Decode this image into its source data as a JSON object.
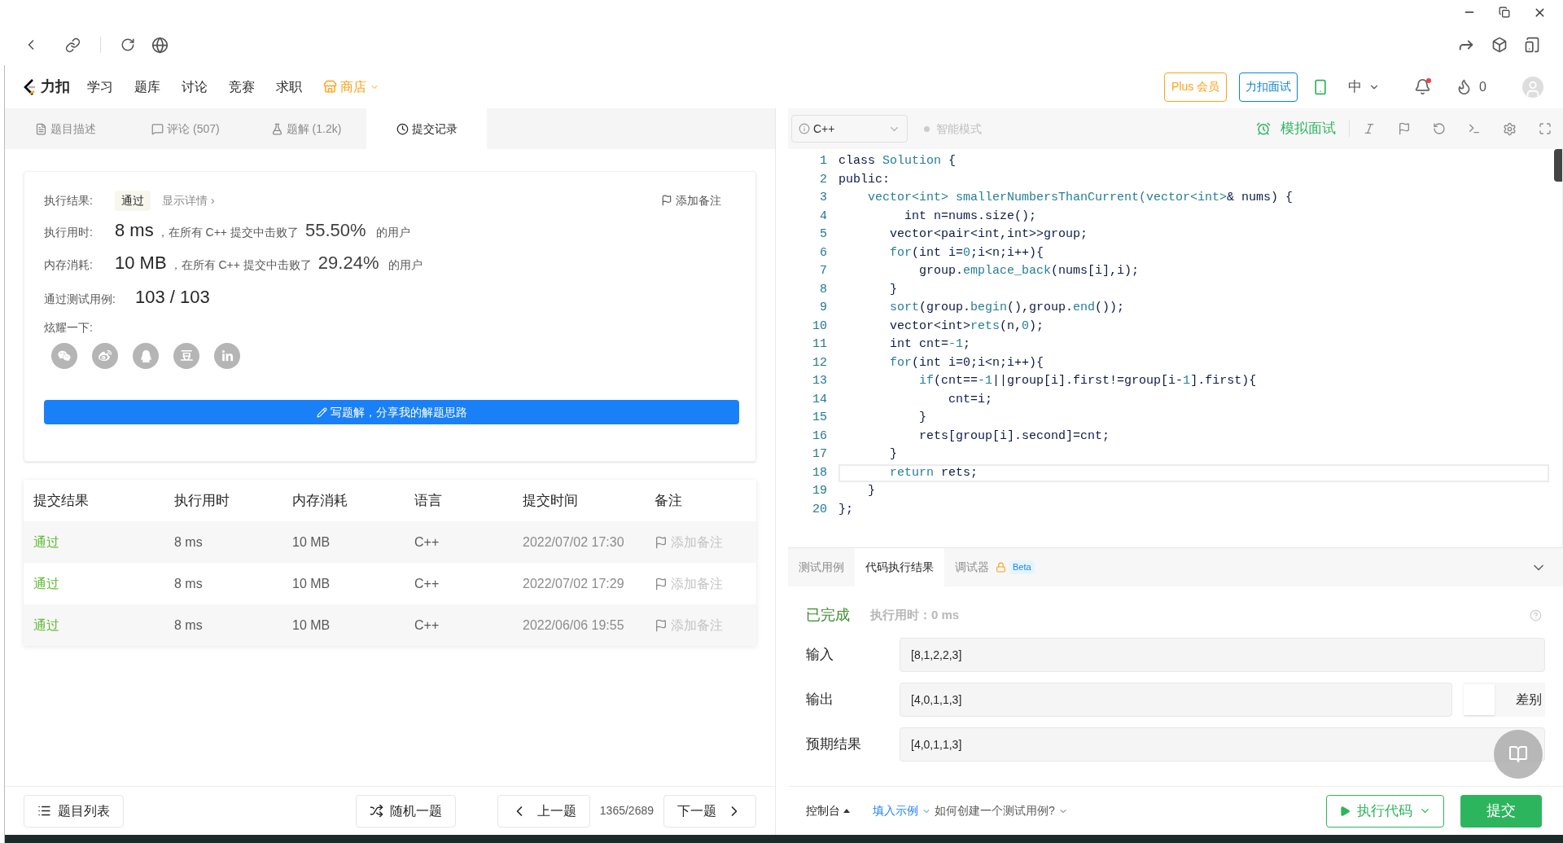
{
  "nav": {
    "logo": "力扣",
    "items": [
      {
        "label": "学习"
      },
      {
        "label": "题库"
      },
      {
        "label": "讨论"
      },
      {
        "label": "竞赛"
      },
      {
        "label": "求职"
      }
    ],
    "shop": "商店",
    "plus": "Plus 会员",
    "interview": "力扣面试",
    "language": "中",
    "coins": "0"
  },
  "left_tabs": [
    {
      "kind": "description",
      "label": "题目描述",
      "selected": false
    },
    {
      "kind": "comments",
      "label": "评论 (507)",
      "selected": false
    },
    {
      "kind": "solutions",
      "label": "题解 (1.2k)",
      "selected": false
    },
    {
      "kind": "submissions",
      "label": "提交记录",
      "selected": true
    }
  ],
  "result": {
    "status_label": "执行结果:",
    "status": "通过",
    "details": "显示详情 ›",
    "add_note": "添加备注",
    "runtime_label": "执行用时:",
    "runtime": "8 ms",
    "runtime_text": "，在所有 C++ 提交中击败了",
    "runtime_pct": "55.50%",
    "runtime_suffix": "的用户",
    "memory_label": "内存消耗:",
    "memory": "10 MB",
    "memory_text": "，在所有 C++ 提交中击败了",
    "memory_pct": "29.24%",
    "memory_suffix": "的用户",
    "tests_label": "通过测试用例:",
    "tests": "103 / 103",
    "share_label": "炫耀一下:",
    "share": [
      {
        "kind": "wechat"
      },
      {
        "kind": "weibo"
      },
      {
        "kind": "qq"
      },
      {
        "kind": "douban",
        "glyph": "豆"
      },
      {
        "kind": "linkedin"
      }
    ],
    "write_button": "写题解，分享我的解题思路"
  },
  "submissions": {
    "columns": [
      "提交结果",
      "执行用时",
      "内存消耗",
      "语言",
      "提交时间",
      "备注"
    ],
    "rows": [
      {
        "status": "通过",
        "runtime": "8 ms",
        "memory": "10 MB",
        "language": "C++",
        "time": "2022/07/02 17:30",
        "note": "添加备注"
      },
      {
        "status": "通过",
        "runtime": "8 ms",
        "memory": "10 MB",
        "language": "C++",
        "time": "2022/07/02 17:29",
        "note": "添加备注"
      },
      {
        "status": "通过",
        "runtime": "8 ms",
        "memory": "10 MB",
        "language": "C++",
        "time": "2022/06/06 19:55",
        "note": "添加备注"
      }
    ]
  },
  "footer": {
    "list": "题目列表",
    "random": "随机一题",
    "prev": "上一题",
    "counter": "1365/2689",
    "next": "下一题"
  },
  "editor": {
    "language": "C++",
    "smart_mode": "智能模式",
    "mock": "模拟面试",
    "lines": [
      {
        "n": "1",
        "active": false,
        "segs": [
          {
            "kind": "plain",
            "text": "class "
          },
          {
            "kind": "accent",
            "text": "Solution"
          },
          {
            "kind": "plain",
            "text": " {"
          }
        ]
      },
      {
        "n": "2",
        "active": false,
        "segs": [
          {
            "kind": "plain",
            "text": "public:"
          }
        ]
      },
      {
        "n": "3",
        "active": false,
        "segs": [
          {
            "kind": "accent",
            "text": "    vector<int> smallerNumbersThanCurrent(vector<int>"
          },
          {
            "kind": "plain",
            "text": "& nums) {"
          }
        ]
      },
      {
        "n": "4",
        "active": false,
        "segs": [
          {
            "kind": "plain",
            "text": "         int n=nums.size();"
          }
        ]
      },
      {
        "n": "5",
        "active": false,
        "segs": [
          {
            "kind": "plain",
            "text": "       vector<pair<int,int>>group;"
          }
        ]
      },
      {
        "n": "6",
        "active": false,
        "segs": [
          {
            "kind": "accent",
            "text": "       for"
          },
          {
            "kind": "plain",
            "text": "(int i="
          },
          {
            "kind": "accent",
            "text": "0"
          },
          {
            "kind": "plain",
            "text": ";i<n;i++){"
          }
        ]
      },
      {
        "n": "7",
        "active": false,
        "segs": [
          {
            "kind": "plain",
            "text": "           group."
          },
          {
            "kind": "accent",
            "text": "emplace_back"
          },
          {
            "kind": "plain",
            "text": "(nums[i],i);"
          }
        ]
      },
      {
        "n": "8",
        "active": false,
        "segs": [
          {
            "kind": "plain",
            "text": "       }"
          }
        ]
      },
      {
        "n": "9",
        "active": false,
        "segs": [
          {
            "kind": "accent",
            "text": "       sort"
          },
          {
            "kind": "plain",
            "text": "(group."
          },
          {
            "kind": "accent",
            "text": "begin"
          },
          {
            "kind": "plain",
            "text": "(),group."
          },
          {
            "kind": "accent",
            "text": "end"
          },
          {
            "kind": "plain",
            "text": "());"
          }
        ]
      },
      {
        "n": "10",
        "active": false,
        "segs": [
          {
            "kind": "plain",
            "text": "       vector<int>"
          },
          {
            "kind": "accent",
            "text": "rets"
          },
          {
            "kind": "plain",
            "text": "(n,"
          },
          {
            "kind": "accent",
            "text": "0"
          },
          {
            "kind": "plain",
            "text": ");"
          }
        ]
      },
      {
        "n": "11",
        "active": false,
        "segs": [
          {
            "kind": "plain",
            "text": "       int cnt="
          },
          {
            "kind": "accent",
            "text": "-1"
          },
          {
            "kind": "plain",
            "text": ";"
          }
        ]
      },
      {
        "n": "12",
        "active": false,
        "segs": [
          {
            "kind": "accent",
            "text": "       for"
          },
          {
            "kind": "plain",
            "text": "(int i=0;i<n;i++){"
          }
        ]
      },
      {
        "n": "13",
        "active": false,
        "segs": [
          {
            "kind": "accent",
            "text": "           if"
          },
          {
            "kind": "plain",
            "text": "(cnt=="
          },
          {
            "kind": "accent",
            "text": "-1"
          },
          {
            "kind": "plain",
            "text": "||group[i].first!=group[i-"
          },
          {
            "kind": "accent",
            "text": "1"
          },
          {
            "kind": "plain",
            "text": "].first){"
          }
        ]
      },
      {
        "n": "14",
        "active": false,
        "segs": [
          {
            "kind": "plain",
            "text": "               cnt=i;"
          }
        ]
      },
      {
        "n": "15",
        "active": false,
        "segs": [
          {
            "kind": "plain",
            "text": "           }"
          }
        ]
      },
      {
        "n": "16",
        "active": false,
        "segs": [
          {
            "kind": "plain",
            "text": "           rets[group[i].second]=cnt;"
          }
        ]
      },
      {
        "n": "17",
        "active": false,
        "segs": [
          {
            "kind": "plain",
            "text": "       }"
          }
        ]
      },
      {
        "n": "18",
        "active": true,
        "segs": [
          {
            "kind": "accent",
            "text": "       return"
          },
          {
            "kind": "plain",
            "text": " rets;"
          }
        ]
      },
      {
        "n": "19",
        "active": false,
        "segs": [
          {
            "kind": "plain",
            "text": "    }"
          }
        ]
      },
      {
        "n": "20",
        "active": false,
        "segs": [
          {
            "kind": "plain",
            "text": "};"
          }
        ]
      }
    ]
  },
  "console": {
    "tabs": [
      {
        "label": "测试用例",
        "selected": false,
        "locked": false
      },
      {
        "label": "代码执行结果",
        "selected": true,
        "locked": false
      },
      {
        "label": "调试器",
        "selected": false,
        "locked": true,
        "badge": "Beta"
      }
    ],
    "status": "已完成",
    "runtime": "执行用时：0 ms",
    "fields": [
      {
        "label": "输入",
        "value": "[8,1,2,2,3]",
        "diff": false
      },
      {
        "label": "输出",
        "value": "[4,0,1,1,3]",
        "diff": true
      },
      {
        "label": "预期结果",
        "value": "[4,0,1,1,3]",
        "diff": false
      }
    ],
    "diff_label": "差别"
  },
  "actions": {
    "console": "控制台",
    "fill": "填入示例",
    "help": "如何创建一个测试用例?",
    "run": "执行代码",
    "submit": "提交"
  }
}
